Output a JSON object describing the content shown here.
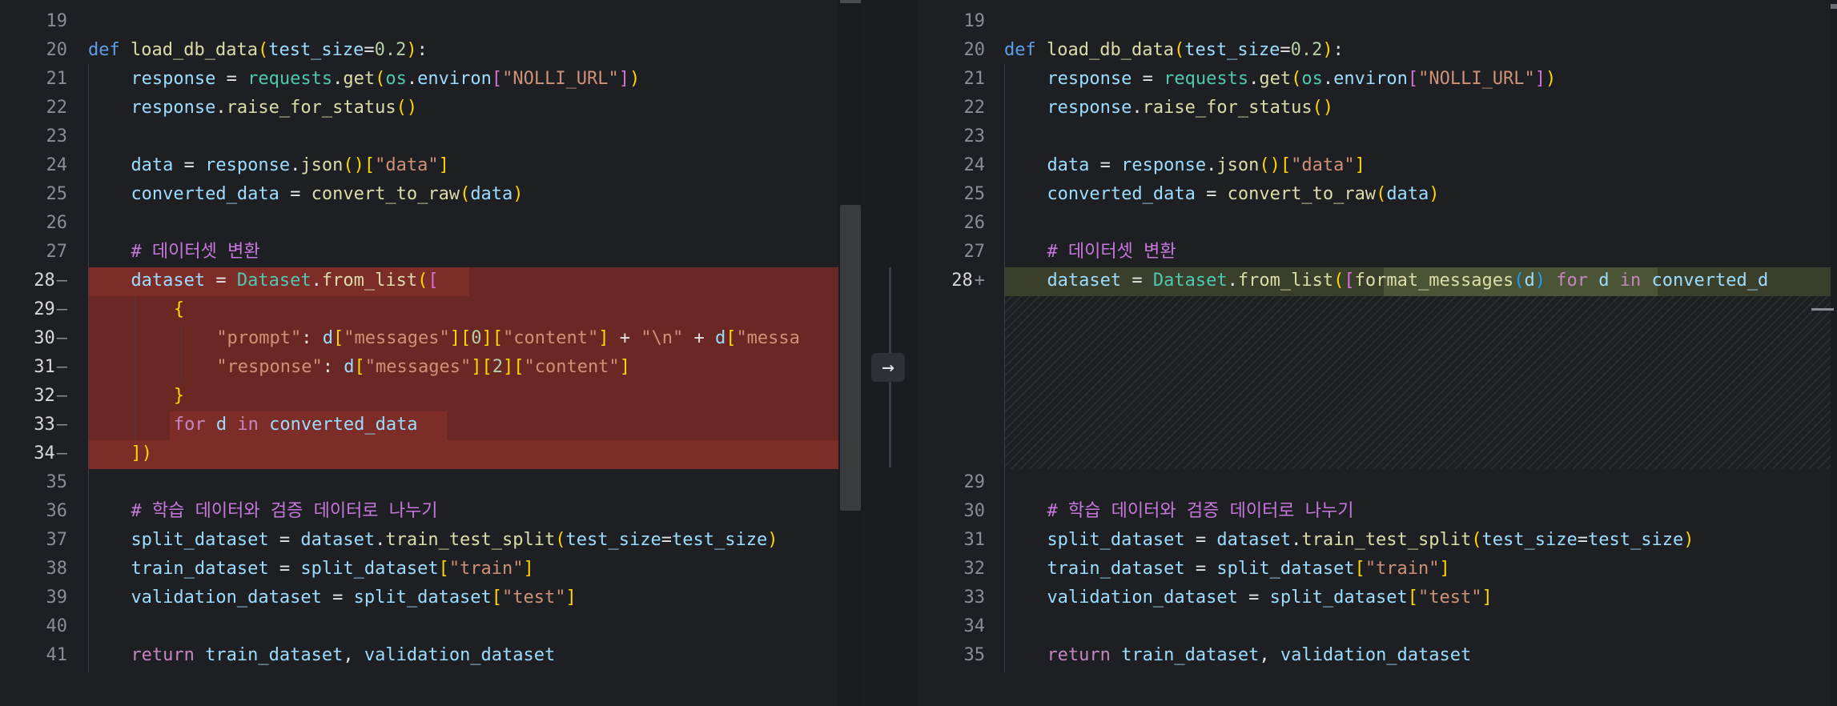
{
  "left": {
    "lines": [
      {
        "no": "19",
        "text": ""
      },
      {
        "no": "20",
        "text": "def load_db_data(test_size=0.2):"
      },
      {
        "no": "21",
        "text": "response = requests.get(os.environ[\"NOLLI_URL\"])"
      },
      {
        "no": "22",
        "text": "response.raise_for_status()"
      },
      {
        "no": "23",
        "text": ""
      },
      {
        "no": "24",
        "text": "data = response.json()[\"data\"]"
      },
      {
        "no": "25",
        "text": "converted_data = convert_to_raw(data)"
      },
      {
        "no": "26",
        "text": ""
      },
      {
        "no": "27",
        "text": "# 데이터셋 변환"
      },
      {
        "no": "28",
        "text": "dataset = Dataset.from_list(["
      },
      {
        "no": "29",
        "text": "{"
      },
      {
        "no": "30",
        "text": "\"prompt\": d[\"messages\"][0][\"content\"] + \"\\n\" + d[\"messa"
      },
      {
        "no": "31",
        "text": "\"response\": d[\"messages\"][2][\"content\"]"
      },
      {
        "no": "32",
        "text": "}"
      },
      {
        "no": "33",
        "text": "for d in converted_data"
      },
      {
        "no": "34",
        "text": "])"
      },
      {
        "no": "35",
        "text": ""
      },
      {
        "no": "36",
        "text": "# 학습 데이터와 검증 데이터로 나누기"
      },
      {
        "no": "37",
        "text": "split_dataset = dataset.train_test_split(test_size=test_size)"
      },
      {
        "no": "38",
        "text": "train_dataset = split_dataset[\"train\"]"
      },
      {
        "no": "39",
        "text": "validation_dataset = split_dataset[\"test\"]"
      },
      {
        "no": "40",
        "text": ""
      },
      {
        "no": "41",
        "text": "return train_dataset, validation_dataset"
      }
    ],
    "deleted_marker": "—"
  },
  "right": {
    "lines": [
      {
        "no": "19",
        "text": ""
      },
      {
        "no": "20",
        "text": "def load_db_data(test_size=0.2):"
      },
      {
        "no": "21",
        "text": "response = requests.get(os.environ[\"NOLLI_URL\"])"
      },
      {
        "no": "22",
        "text": "response.raise_for_status()"
      },
      {
        "no": "23",
        "text": ""
      },
      {
        "no": "24",
        "text": "data = response.json()[\"data\"]"
      },
      {
        "no": "25",
        "text": "converted_data = convert_to_raw(data)"
      },
      {
        "no": "26",
        "text": ""
      },
      {
        "no": "27",
        "text": "# 데이터셋 변환"
      },
      {
        "no": "28",
        "text": "dataset = Dataset.from_list([format_messages(d) for d in converted_d"
      },
      {
        "no": "29",
        "text": ""
      },
      {
        "no": "30",
        "text": "# 학습 데이터와 검증 데이터로 나누기"
      },
      {
        "no": "31",
        "text": "split_dataset = dataset.train_test_split(test_size=test_size)"
      },
      {
        "no": "32",
        "text": "train_dataset = split_dataset[\"train\"]"
      },
      {
        "no": "33",
        "text": "validation_dataset = split_dataset[\"test\"]"
      },
      {
        "no": "34",
        "text": ""
      },
      {
        "no": "35",
        "text": "return train_dataset, validation_dataset"
      }
    ],
    "added_marker": "+"
  },
  "apply_arrow_icon": "→",
  "colors": {
    "deleted_bg": "#6b2724",
    "added_bg": "#3a3f2b",
    "background": "#1e1f22"
  }
}
